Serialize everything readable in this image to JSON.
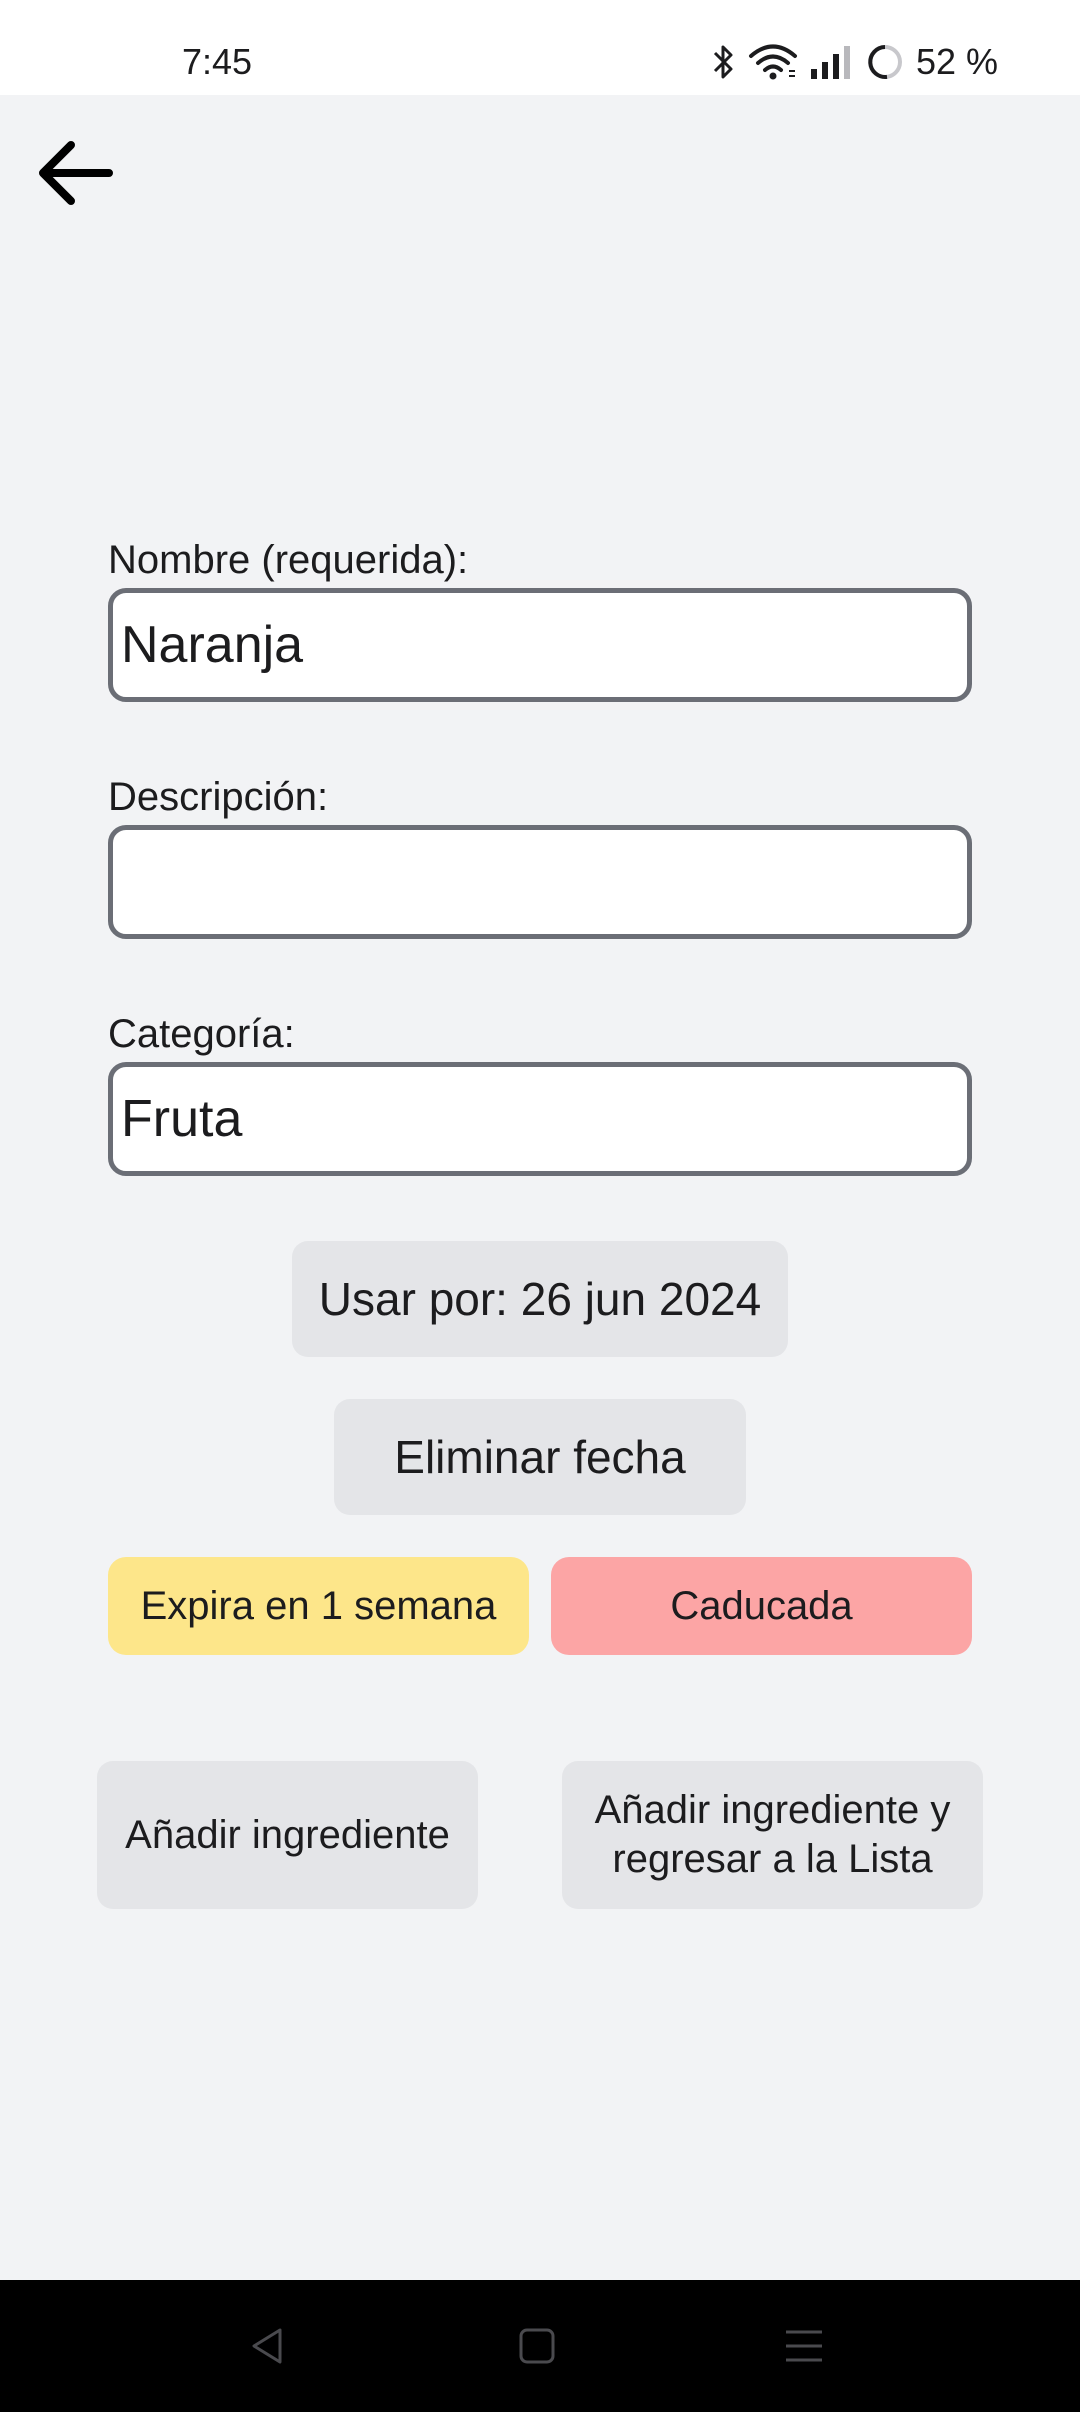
{
  "status_bar": {
    "time": "7:45",
    "battery": "52 %",
    "icons": [
      "bluetooth-icon",
      "wifi-icon",
      "signal-icon",
      "battery-ring-icon"
    ]
  },
  "navigation": {
    "back_icon": "arrow-left-icon"
  },
  "form": {
    "name": {
      "label": "Nombre (requerida):",
      "value": "Naranja"
    },
    "description": {
      "label": "Descripción:",
      "value": ""
    },
    "category": {
      "label": "Categoría:",
      "value": "Fruta"
    },
    "use_by_button": "Usar por: 26 jun 2024",
    "remove_date_button": "Eliminar fecha"
  },
  "status_chips": {
    "expires_soon": {
      "label": "Expira en 1 semana",
      "color": "#fde68a"
    },
    "expired": {
      "label": "Caducada",
      "color": "#fca5a5"
    }
  },
  "actions": {
    "add_ingredient": "Añadir ingrediente",
    "add_and_return_line1": "Añadir ingrediente y",
    "add_and_return_line2": "regresar a la Lista"
  },
  "system_nav": {
    "icons": [
      "nav-back-icon",
      "nav-home-icon",
      "nav-recents-icon"
    ]
  }
}
